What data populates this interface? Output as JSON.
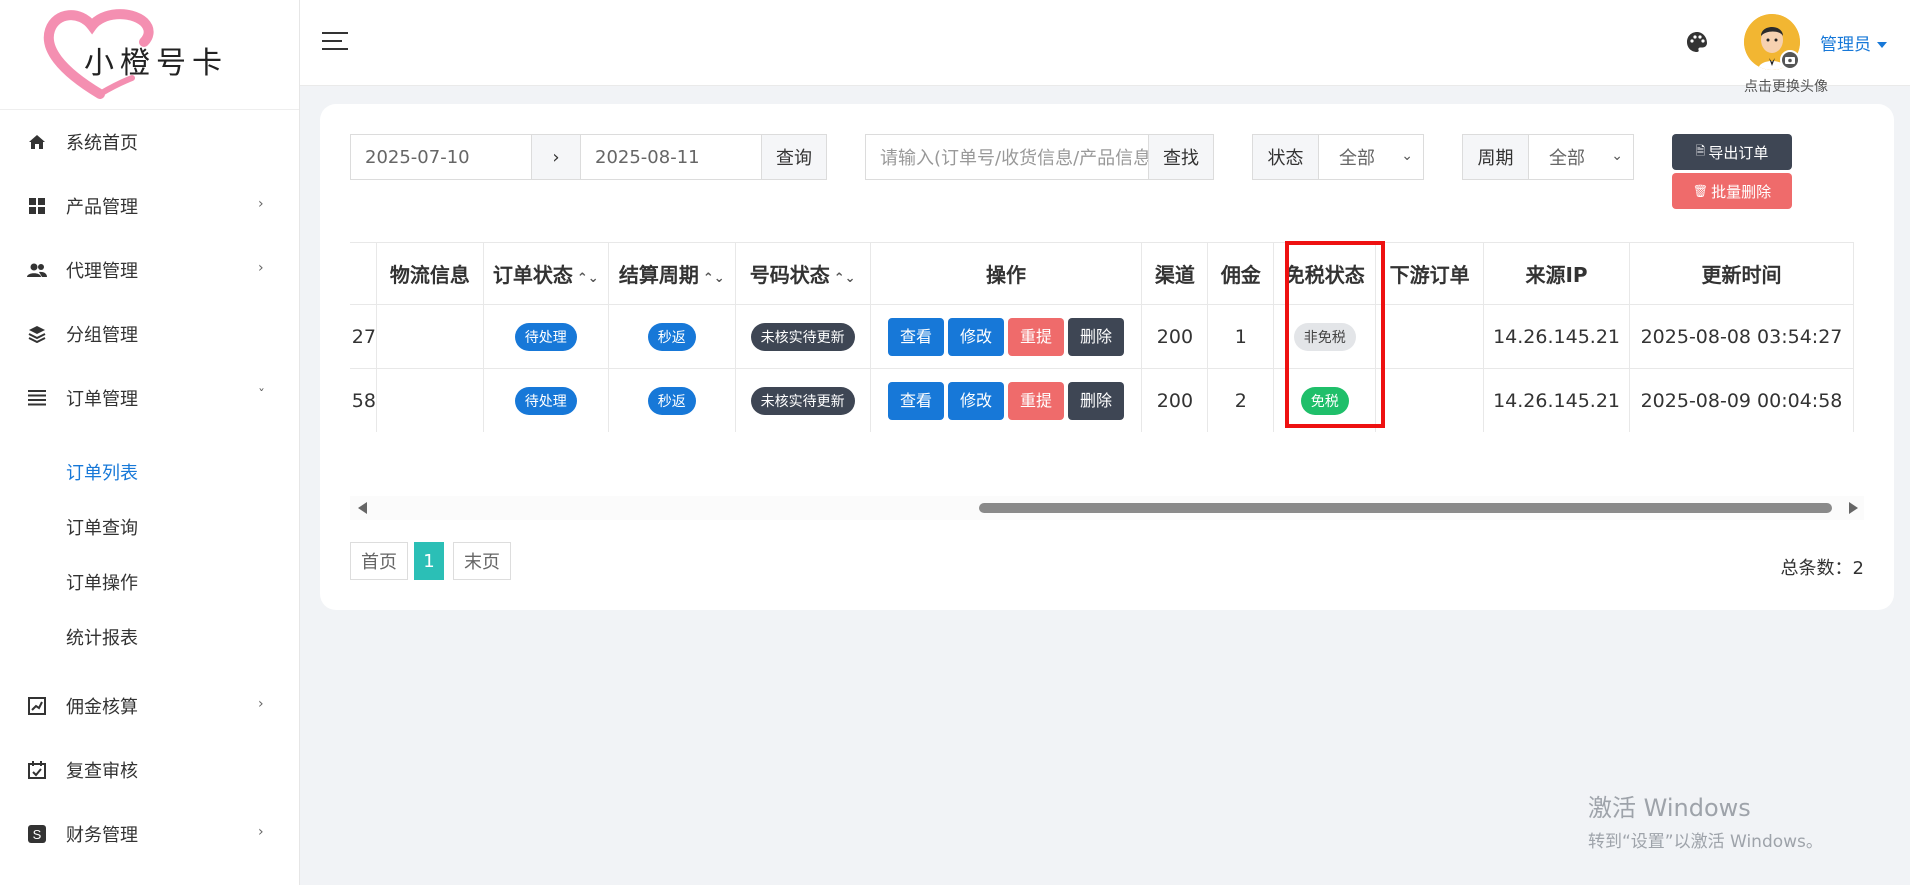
{
  "app": {
    "brand": "小橙号卡"
  },
  "sidebar": {
    "items": [
      {
        "label": "系统首页",
        "icon": "home-icon",
        "has_submenu": false
      },
      {
        "label": "产品管理",
        "icon": "grid-icon",
        "has_submenu": true
      },
      {
        "label": "代理管理",
        "icon": "people-icon",
        "has_submenu": true
      },
      {
        "label": "分组管理",
        "icon": "layers-icon",
        "has_submenu": false
      },
      {
        "label": "订单管理",
        "icon": "list-icon",
        "has_submenu": true,
        "expanded": true
      }
    ],
    "order_submenu": [
      {
        "label": "订单列表",
        "active": true
      },
      {
        "label": "订单查询",
        "active": false
      },
      {
        "label": "订单操作",
        "active": false
      },
      {
        "label": "统计报表",
        "active": false
      }
    ],
    "items_after": [
      {
        "label": "佣金核算",
        "icon": "chart-box-icon",
        "has_submenu": true
      },
      {
        "label": "复查审核",
        "icon": "calendar-check-icon",
        "has_submenu": false
      },
      {
        "label": "财务管理",
        "icon": "dollar-box-icon",
        "has_submenu": true
      }
    ],
    "chevron_right": "›",
    "chevron_down": "ˇ"
  },
  "topbar": {
    "avatar_caption": "点击更换头像",
    "user_name": "管理员"
  },
  "filters": {
    "date_from": "2025-07-10",
    "date_sep": "›",
    "date_to": "2025-08-11",
    "query_button": "查询",
    "search_placeholder": "请输入(订单号/收货信息/产品信息)",
    "search_button": "查找",
    "status_label": "状态",
    "status_value": "全部",
    "period_label": "周期",
    "period_value": "全部",
    "export_button": "导出订单",
    "batch_delete_button": "批量删除"
  },
  "table": {
    "columns": [
      "物流信息",
      "订单状态",
      "结算周期",
      "号码状态",
      "操作",
      "渠道",
      "佣金",
      "免税状态",
      "下游订单",
      "来源IP",
      "更新时间"
    ],
    "sortable": [
      "订单状态",
      "结算周期",
      "号码状态"
    ],
    "sort_glyph": "⌃⌄",
    "action_labels": {
      "view": "查看",
      "edit": "修改",
      "reset": "重提",
      "delete": "删除"
    },
    "rows": [
      {
        "cut_prefix": "27",
        "logistics": "",
        "order_status": "待处理",
        "period": "秒返",
        "number_status": "未核实待更新",
        "channel": "200",
        "commission": "1",
        "tax_status": "非免税",
        "tax_status_type": "gray",
        "downstream": "",
        "ip": "14.26.145.21",
        "updated": "2025-08-08 03:54:27"
      },
      {
        "cut_prefix": "58",
        "logistics": "",
        "order_status": "待处理",
        "period": "秒返",
        "number_status": "未核实待更新",
        "channel": "200",
        "commission": "2",
        "tax_status": "免税",
        "tax_status_type": "green",
        "downstream": "",
        "ip": "14.26.145.21",
        "updated": "2025-08-09 00:04:58"
      }
    ]
  },
  "pagination": {
    "first": "首页",
    "current": "1",
    "last": "末页",
    "total": "总条数：2"
  },
  "watermark": {
    "line1": "激活 Windows",
    "line2": "转到“设置”以激活 Windows。"
  },
  "colors": {
    "accent_blue": "#1778d8",
    "danger_red": "#ef6b6b",
    "dark": "#3e4654",
    "success_green": "#1fbf6a",
    "page_active": "#2bbfb6",
    "highlight_red": "#ee1111"
  }
}
